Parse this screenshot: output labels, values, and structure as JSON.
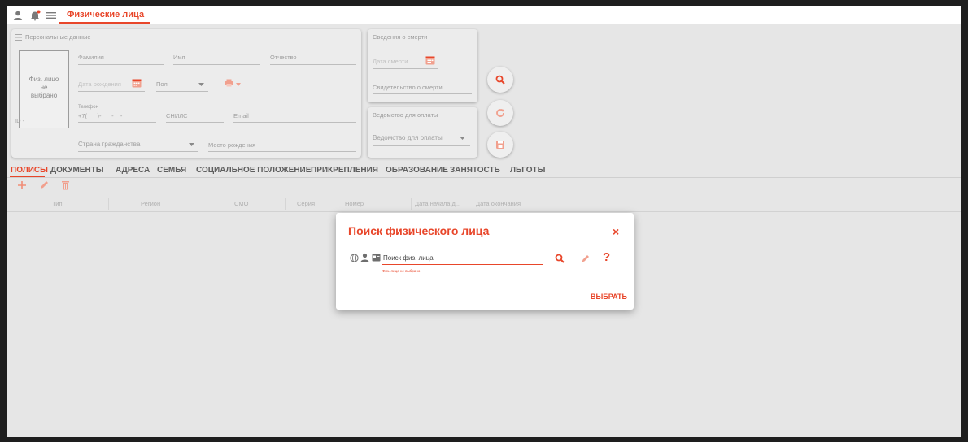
{
  "topbar": {
    "icons": [
      "user-icon",
      "bell-icon",
      "menu-icon"
    ],
    "tab_title": "Физические лица",
    "accent": "#e8462a"
  },
  "personal": {
    "title": "Персональные данные",
    "photo_text_line1": "Физ. лицо",
    "photo_text_line2": "не",
    "photo_text_line3": "выбрано",
    "id_label": "ID -",
    "surname": "Фамилия",
    "name": "Имя",
    "patronymic": "Отчество",
    "birth_date": "Дата рождения",
    "gender": "Пол",
    "phone_label": "Телефон",
    "phone_value": "+7(___)-___-__-__",
    "snils": "СНИЛС",
    "email": "Email",
    "citizenship": "Страна гражданства",
    "birth_place": "Место рождения"
  },
  "death": {
    "title": "Сведения о смерти",
    "date": "Дата смерти",
    "certificate": "Свидетельство о смерти"
  },
  "payment": {
    "title": "Ведомство для оплаты",
    "field": "Ведомство для оплаты"
  },
  "tabs": [
    {
      "label": "ПОЛИСЫ",
      "active": true
    },
    {
      "label": "ДОКУМЕНТЫ"
    },
    {
      "label": "АДРЕСА"
    },
    {
      "label": "СЕМЬЯ"
    },
    {
      "label": "СОЦИАЛЬНОЕ ПОЛОЖЕНИЕ"
    },
    {
      "label": "ПРИКРЕПЛЕНИЯ"
    },
    {
      "label": "ОБРАЗОВАНИЕ"
    },
    {
      "label": "ЗАНЯТОСТЬ"
    },
    {
      "label": "ЛЬГОТЫ"
    }
  ],
  "table": {
    "columns": [
      "Тип",
      "Регион",
      "СМО",
      "Серия",
      "Номер",
      "Дата начала д...",
      "Дата окончания"
    ]
  },
  "modal": {
    "title": "Поиск физического лица",
    "close": "×",
    "search_placeholder": "Поиск физ. лица",
    "error_text": "Физ. лицо не выбрано",
    "help": "?",
    "select_button": "ВЫБРАТЬ"
  }
}
